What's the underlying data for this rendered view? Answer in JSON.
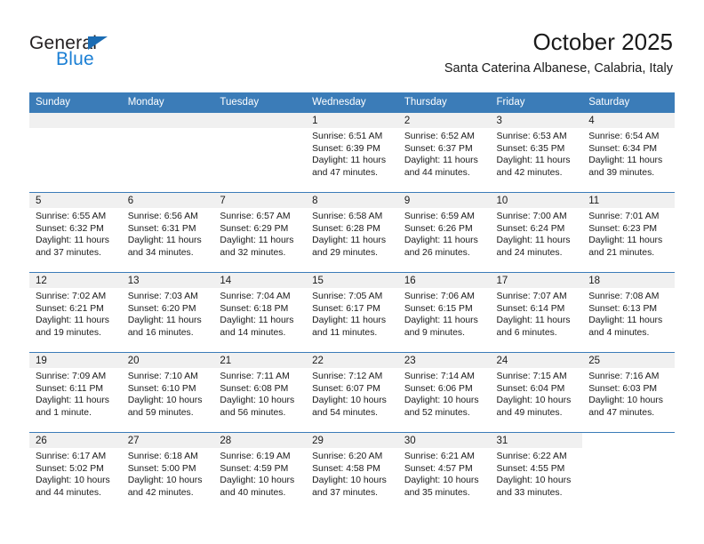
{
  "logo": {
    "word_top": "General",
    "word_bottom": "Blue",
    "triangle_color": "#1b6cb3",
    "blue_color": "#1b7fd4",
    "icon": "general-blue-logo"
  },
  "header": {
    "title": "October 2025",
    "subtitle": "Santa Caterina Albanese, Calabria, Italy"
  },
  "colors": {
    "header_band": "#3b7cb8",
    "daynum_band": "#f0f0f0",
    "text": "#1a1a1a"
  },
  "weekday_headers": [
    "Sunday",
    "Monday",
    "Tuesday",
    "Wednesday",
    "Thursday",
    "Friday",
    "Saturday"
  ],
  "weeks": [
    [
      {
        "day": "",
        "sunrise": "",
        "sunset": "",
        "daylight_line1": "",
        "daylight_line2": "",
        "empty": true
      },
      {
        "day": "",
        "sunrise": "",
        "sunset": "",
        "daylight_line1": "",
        "daylight_line2": "",
        "empty": true
      },
      {
        "day": "",
        "sunrise": "",
        "sunset": "",
        "daylight_line1": "",
        "daylight_line2": "",
        "empty": true
      },
      {
        "day": "1",
        "sunrise": "Sunrise: 6:51 AM",
        "sunset": "Sunset: 6:39 PM",
        "daylight_line1": "Daylight: 11 hours",
        "daylight_line2": "and 47 minutes."
      },
      {
        "day": "2",
        "sunrise": "Sunrise: 6:52 AM",
        "sunset": "Sunset: 6:37 PM",
        "daylight_line1": "Daylight: 11 hours",
        "daylight_line2": "and 44 minutes."
      },
      {
        "day": "3",
        "sunrise": "Sunrise: 6:53 AM",
        "sunset": "Sunset: 6:35 PM",
        "daylight_line1": "Daylight: 11 hours",
        "daylight_line2": "and 42 minutes."
      },
      {
        "day": "4",
        "sunrise": "Sunrise: 6:54 AM",
        "sunset": "Sunset: 6:34 PM",
        "daylight_line1": "Daylight: 11 hours",
        "daylight_line2": "and 39 minutes."
      }
    ],
    [
      {
        "day": "5",
        "sunrise": "Sunrise: 6:55 AM",
        "sunset": "Sunset: 6:32 PM",
        "daylight_line1": "Daylight: 11 hours",
        "daylight_line2": "and 37 minutes."
      },
      {
        "day": "6",
        "sunrise": "Sunrise: 6:56 AM",
        "sunset": "Sunset: 6:31 PM",
        "daylight_line1": "Daylight: 11 hours",
        "daylight_line2": "and 34 minutes."
      },
      {
        "day": "7",
        "sunrise": "Sunrise: 6:57 AM",
        "sunset": "Sunset: 6:29 PM",
        "daylight_line1": "Daylight: 11 hours",
        "daylight_line2": "and 32 minutes."
      },
      {
        "day": "8",
        "sunrise": "Sunrise: 6:58 AM",
        "sunset": "Sunset: 6:28 PM",
        "daylight_line1": "Daylight: 11 hours",
        "daylight_line2": "and 29 minutes."
      },
      {
        "day": "9",
        "sunrise": "Sunrise: 6:59 AM",
        "sunset": "Sunset: 6:26 PM",
        "daylight_line1": "Daylight: 11 hours",
        "daylight_line2": "and 26 minutes."
      },
      {
        "day": "10",
        "sunrise": "Sunrise: 7:00 AM",
        "sunset": "Sunset: 6:24 PM",
        "daylight_line1": "Daylight: 11 hours",
        "daylight_line2": "and 24 minutes."
      },
      {
        "day": "11",
        "sunrise": "Sunrise: 7:01 AM",
        "sunset": "Sunset: 6:23 PM",
        "daylight_line1": "Daylight: 11 hours",
        "daylight_line2": "and 21 minutes."
      }
    ],
    [
      {
        "day": "12",
        "sunrise": "Sunrise: 7:02 AM",
        "sunset": "Sunset: 6:21 PM",
        "daylight_line1": "Daylight: 11 hours",
        "daylight_line2": "and 19 minutes."
      },
      {
        "day": "13",
        "sunrise": "Sunrise: 7:03 AM",
        "sunset": "Sunset: 6:20 PM",
        "daylight_line1": "Daylight: 11 hours",
        "daylight_line2": "and 16 minutes."
      },
      {
        "day": "14",
        "sunrise": "Sunrise: 7:04 AM",
        "sunset": "Sunset: 6:18 PM",
        "daylight_line1": "Daylight: 11 hours",
        "daylight_line2": "and 14 minutes."
      },
      {
        "day": "15",
        "sunrise": "Sunrise: 7:05 AM",
        "sunset": "Sunset: 6:17 PM",
        "daylight_line1": "Daylight: 11 hours",
        "daylight_line2": "and 11 minutes."
      },
      {
        "day": "16",
        "sunrise": "Sunrise: 7:06 AM",
        "sunset": "Sunset: 6:15 PM",
        "daylight_line1": "Daylight: 11 hours",
        "daylight_line2": "and 9 minutes."
      },
      {
        "day": "17",
        "sunrise": "Sunrise: 7:07 AM",
        "sunset": "Sunset: 6:14 PM",
        "daylight_line1": "Daylight: 11 hours",
        "daylight_line2": "and 6 minutes."
      },
      {
        "day": "18",
        "sunrise": "Sunrise: 7:08 AM",
        "sunset": "Sunset: 6:13 PM",
        "daylight_line1": "Daylight: 11 hours",
        "daylight_line2": "and 4 minutes."
      }
    ],
    [
      {
        "day": "19",
        "sunrise": "Sunrise: 7:09 AM",
        "sunset": "Sunset: 6:11 PM",
        "daylight_line1": "Daylight: 11 hours",
        "daylight_line2": "and 1 minute."
      },
      {
        "day": "20",
        "sunrise": "Sunrise: 7:10 AM",
        "sunset": "Sunset: 6:10 PM",
        "daylight_line1": "Daylight: 10 hours",
        "daylight_line2": "and 59 minutes."
      },
      {
        "day": "21",
        "sunrise": "Sunrise: 7:11 AM",
        "sunset": "Sunset: 6:08 PM",
        "daylight_line1": "Daylight: 10 hours",
        "daylight_line2": "and 56 minutes."
      },
      {
        "day": "22",
        "sunrise": "Sunrise: 7:12 AM",
        "sunset": "Sunset: 6:07 PM",
        "daylight_line1": "Daylight: 10 hours",
        "daylight_line2": "and 54 minutes."
      },
      {
        "day": "23",
        "sunrise": "Sunrise: 7:14 AM",
        "sunset": "Sunset: 6:06 PM",
        "daylight_line1": "Daylight: 10 hours",
        "daylight_line2": "and 52 minutes."
      },
      {
        "day": "24",
        "sunrise": "Sunrise: 7:15 AM",
        "sunset": "Sunset: 6:04 PM",
        "daylight_line1": "Daylight: 10 hours",
        "daylight_line2": "and 49 minutes."
      },
      {
        "day": "25",
        "sunrise": "Sunrise: 7:16 AM",
        "sunset": "Sunset: 6:03 PM",
        "daylight_line1": "Daylight: 10 hours",
        "daylight_line2": "and 47 minutes."
      }
    ],
    [
      {
        "day": "26",
        "sunrise": "Sunrise: 6:17 AM",
        "sunset": "Sunset: 5:02 PM",
        "daylight_line1": "Daylight: 10 hours",
        "daylight_line2": "and 44 minutes."
      },
      {
        "day": "27",
        "sunrise": "Sunrise: 6:18 AM",
        "sunset": "Sunset: 5:00 PM",
        "daylight_line1": "Daylight: 10 hours",
        "daylight_line2": "and 42 minutes."
      },
      {
        "day": "28",
        "sunrise": "Sunrise: 6:19 AM",
        "sunset": "Sunset: 4:59 PM",
        "daylight_line1": "Daylight: 10 hours",
        "daylight_line2": "and 40 minutes."
      },
      {
        "day": "29",
        "sunrise": "Sunrise: 6:20 AM",
        "sunset": "Sunset: 4:58 PM",
        "daylight_line1": "Daylight: 10 hours",
        "daylight_line2": "and 37 minutes."
      },
      {
        "day": "30",
        "sunrise": "Sunrise: 6:21 AM",
        "sunset": "Sunset: 4:57 PM",
        "daylight_line1": "Daylight: 10 hours",
        "daylight_line2": "and 35 minutes."
      },
      {
        "day": "31",
        "sunrise": "Sunrise: 6:22 AM",
        "sunset": "Sunset: 4:55 PM",
        "daylight_line1": "Daylight: 10 hours",
        "daylight_line2": "and 33 minutes."
      },
      {
        "day": "",
        "sunrise": "",
        "sunset": "",
        "daylight_line1": "",
        "daylight_line2": "",
        "blank": true
      }
    ]
  ]
}
